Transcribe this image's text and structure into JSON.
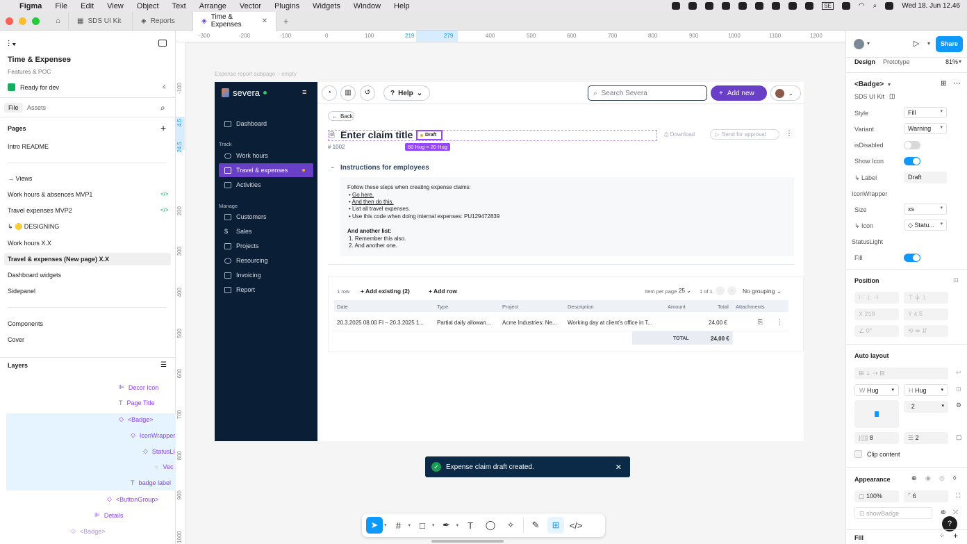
{
  "menubar": {
    "app": "Figma",
    "items": [
      "File",
      "Edit",
      "View",
      "Object",
      "Text",
      "Arrange",
      "Vector",
      "Plugins",
      "Widgets",
      "Window",
      "Help"
    ],
    "se_badge": "SE",
    "datetime": "Wed 18. Jun 12.46"
  },
  "tabs": [
    {
      "label": "SDS UI Kit"
    },
    {
      "label": "Reports"
    },
    {
      "label": "Time & Expenses"
    }
  ],
  "left": {
    "file_title": "Time & Expenses",
    "subtitle": "Features & POC",
    "status": "Ready for dev",
    "status_count": "4",
    "tabs": [
      "File",
      "Assets"
    ],
    "pages_label": "Pages",
    "pages": [
      "Intro README",
      "→ Views",
      "Work hours & absences MVP1",
      "Travel expenses MVP2",
      "↳ 🟡 DESIGNING",
      "Work hours X.X",
      "Travel & expenses (New page) X.X",
      "Dashboard widgets",
      "Sidepanel",
      "Components",
      "Cover"
    ],
    "layers_label": "Layers",
    "layers": [
      "Decor Icon",
      "Page Title",
      "<Badge>",
      "IconWrapper",
      "StatusLi",
      "Vec",
      "badge label",
      "<ButtonGroup>",
      "Details",
      "<Badge>"
    ]
  },
  "rulers": {
    "h": [
      "-300",
      "-200",
      "-100",
      "0",
      "100",
      "219",
      "279",
      "400",
      "500",
      "600",
      "700",
      "800",
      "900",
      "1000",
      "1100",
      "1200"
    ],
    "v": [
      "-100",
      "4.5",
      "24.5",
      "200",
      "300",
      "400",
      "500",
      "600",
      "700",
      "800",
      "900",
      "1000"
    ]
  },
  "frame_label": "Expense report subpage – empty",
  "severa": {
    "brand": "severa",
    "nav_top": [
      "Dashboard"
    ],
    "track_label": "Track",
    "track": [
      "Work hours",
      "Travel & expenses",
      "Activities"
    ],
    "manage_label": "Manage",
    "manage": [
      "Customers",
      "Sales",
      "Projects",
      "Resourcing",
      "Invoicing",
      "Report"
    ],
    "help": "Help",
    "search_placeholder": "Search Severa",
    "add_new": "Add new",
    "back": "Back",
    "claim_title": "Enter claim title",
    "badge": "Draft",
    "size_hint": "60 Hug × 20 Hug",
    "claim_id": "# 1002",
    "download": "Download",
    "send": "Send for approval",
    "instructions_title": "Instructions for employees",
    "instr_intro": "Follow these steps when creating expense claims:",
    "instr_items": [
      "Go here.",
      "And then do this.",
      "List all travel expenses.",
      "Use this code when doing internal expenses: PU129472839"
    ],
    "another_list": "And another list:",
    "another_items": [
      "1. Remember this also.",
      "2. And another one."
    ],
    "rows_count": "1 row",
    "add_existing": "Add existing (2)",
    "add_row": "Add row",
    "items_per_page": "Item per page",
    "per_page_value": "25",
    "page_of": "1 of 1",
    "grouping": "No grouping",
    "columns": [
      "Date",
      "Type",
      "Project",
      "Description",
      "Amount",
      "Total",
      "Attachments"
    ],
    "row": {
      "date": "20.3.2025 08.00 FI – 20.3.2025 1...",
      "type": "Partial daily allowan...",
      "project": "Acme Industries: Ne...",
      "description": "Working day at client's office in T...",
      "total": "24,00 €"
    },
    "total_label": "TOTAL",
    "total_value": "24,00 €"
  },
  "toast": "Expense claim draft created.",
  "right": {
    "tabs": [
      "Design",
      "Prototype"
    ],
    "zoom": "81%",
    "share": "Share",
    "component": "<Badge>",
    "library": "SDS UI Kit",
    "props": [
      {
        "label": "Style",
        "value": "Fill"
      },
      {
        "label": "Variant",
        "value": "Warning"
      }
    ],
    "is_disabled": "isDisabled",
    "show_icon": "Show Icon",
    "label_label": "↳ Label",
    "label_value": "Draft",
    "iconwrapper": "IconWrapper",
    "size_label": "Size",
    "size_value": "xs",
    "icon_label": "↳ Icon",
    "icon_value": "Statu...",
    "statuslight": "StatusLight",
    "fill_label": "Fill",
    "position": "Position",
    "x_value": "219",
    "y_value": "4.5",
    "rotation": "0°",
    "auto_layout": "Auto layout",
    "w_value": "Hug",
    "h_value": "Hug",
    "gap_value": "2",
    "pad_h": "8",
    "pad_v": "2",
    "clip": "Clip content",
    "appearance": "Appearance",
    "opacity": "100%",
    "radius": "6",
    "var_placeholder": "showBadge",
    "fill_section": "Fill"
  },
  "colors": {
    "accent": "#0d99ff",
    "purple": "#6a3fc7",
    "navy": "#0a1e35",
    "warning": "#f5a623"
  }
}
